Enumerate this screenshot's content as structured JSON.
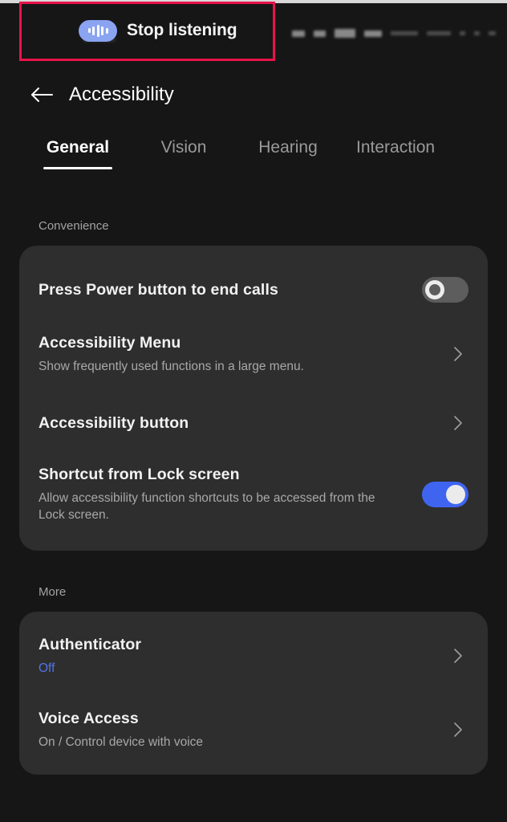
{
  "statusbar": {
    "voice_assistant": {
      "icon": "voice-waveform-icon",
      "label": "Stop listening"
    },
    "obscured_indicators": "blurred status icons"
  },
  "annotation": {
    "color": "#e8134a",
    "target": "Stop listening voice assistant pill"
  },
  "header": {
    "back_icon": "arrow-left-icon",
    "title": "Accessibility"
  },
  "tabs": [
    {
      "label": "General",
      "active": true
    },
    {
      "label": "Vision",
      "active": false
    },
    {
      "label": "Hearing",
      "active": false
    },
    {
      "label": "Interaction",
      "active": false
    }
  ],
  "sections": [
    {
      "label": "Convenience",
      "rows": [
        {
          "title": "Press Power button to end calls",
          "subtitle": "",
          "control": "toggle",
          "toggle_state": "off"
        },
        {
          "title": "Accessibility Menu",
          "subtitle": "Show frequently used functions in a large menu.",
          "control": "chevron",
          "toggle_state": ""
        },
        {
          "title": "Accessibility button",
          "subtitle": "",
          "control": "chevron",
          "toggle_state": ""
        },
        {
          "title": "Shortcut from Lock screen",
          "subtitle": "Allow accessibility function shortcuts to be accessed from the Lock screen.",
          "control": "toggle",
          "toggle_state": "on"
        }
      ]
    },
    {
      "label": "More",
      "rows": [
        {
          "title": "Authenticator",
          "subtitle": "Off",
          "subtitle_accent": true,
          "control": "chevron",
          "toggle_state": ""
        },
        {
          "title": "Voice Access",
          "subtitle": "On / Control device with voice",
          "subtitle_accent": false,
          "control": "chevron",
          "toggle_state": ""
        }
      ]
    }
  ],
  "colors": {
    "page_background": "#161616",
    "card_background": "#2e2e2e",
    "accent_blue": "#3f65f0",
    "annotation_red": "#e8134a",
    "toggle_off_track": "#5d5d5d",
    "voice_pill_blue": "#8aa4f2"
  }
}
